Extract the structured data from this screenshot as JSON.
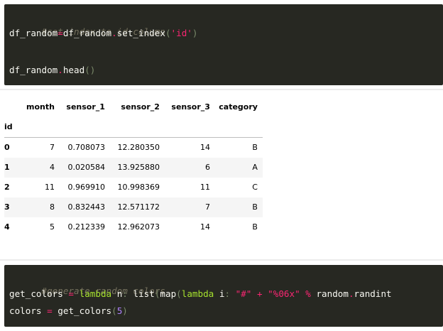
{
  "cell1": {
    "comment": "#set index to id column",
    "line2": {
      "lhs": "df_random",
      "op": "=",
      "obj": "df_random",
      "dot": ".",
      "method": "set_index",
      "open": "(",
      "arg": "'id'",
      "close": ")"
    },
    "line4": {
      "obj": "df_random",
      "dot": ".",
      "method": "head",
      "open": "(",
      "close": ")"
    }
  },
  "table": {
    "columns": [
      "month",
      "sensor_1",
      "sensor_2",
      "sensor_3",
      "category"
    ],
    "index_name": "id",
    "rows": [
      {
        "id": "0",
        "cells": [
          "7",
          "0.708073",
          "12.280350",
          "14",
          "B"
        ]
      },
      {
        "id": "1",
        "cells": [
          "4",
          "0.020584",
          "13.925880",
          "6",
          "A"
        ]
      },
      {
        "id": "2",
        "cells": [
          "11",
          "0.969910",
          "10.998369",
          "11",
          "C"
        ]
      },
      {
        "id": "3",
        "cells": [
          "8",
          "0.832443",
          "12.571172",
          "7",
          "B"
        ]
      },
      {
        "id": "4",
        "cells": [
          "5",
          "0.212339",
          "12.962073",
          "14",
          "B"
        ]
      }
    ]
  },
  "cell2": {
    "comment": "#generate random colors",
    "line2": {
      "name": "get_colors",
      "eq": "=",
      "lambda1": "lambda",
      "param": "n",
      "colon": ":",
      "list": "list",
      "open1": "(",
      "map": "map",
      "open2": "(",
      "lambda2": "lambda",
      "iparam": "i",
      "colon2": ":",
      "hash": "\"#\"",
      "plus": "+",
      "fmt": "\"%06x\"",
      "pct": "%",
      "random": "random",
      "dot": ".",
      "randint": "randint"
    },
    "line3": {
      "name": "colors",
      "eq": "=",
      "fn": "get_colors",
      "open": "(",
      "num": "5",
      "close": ")"
    }
  }
}
